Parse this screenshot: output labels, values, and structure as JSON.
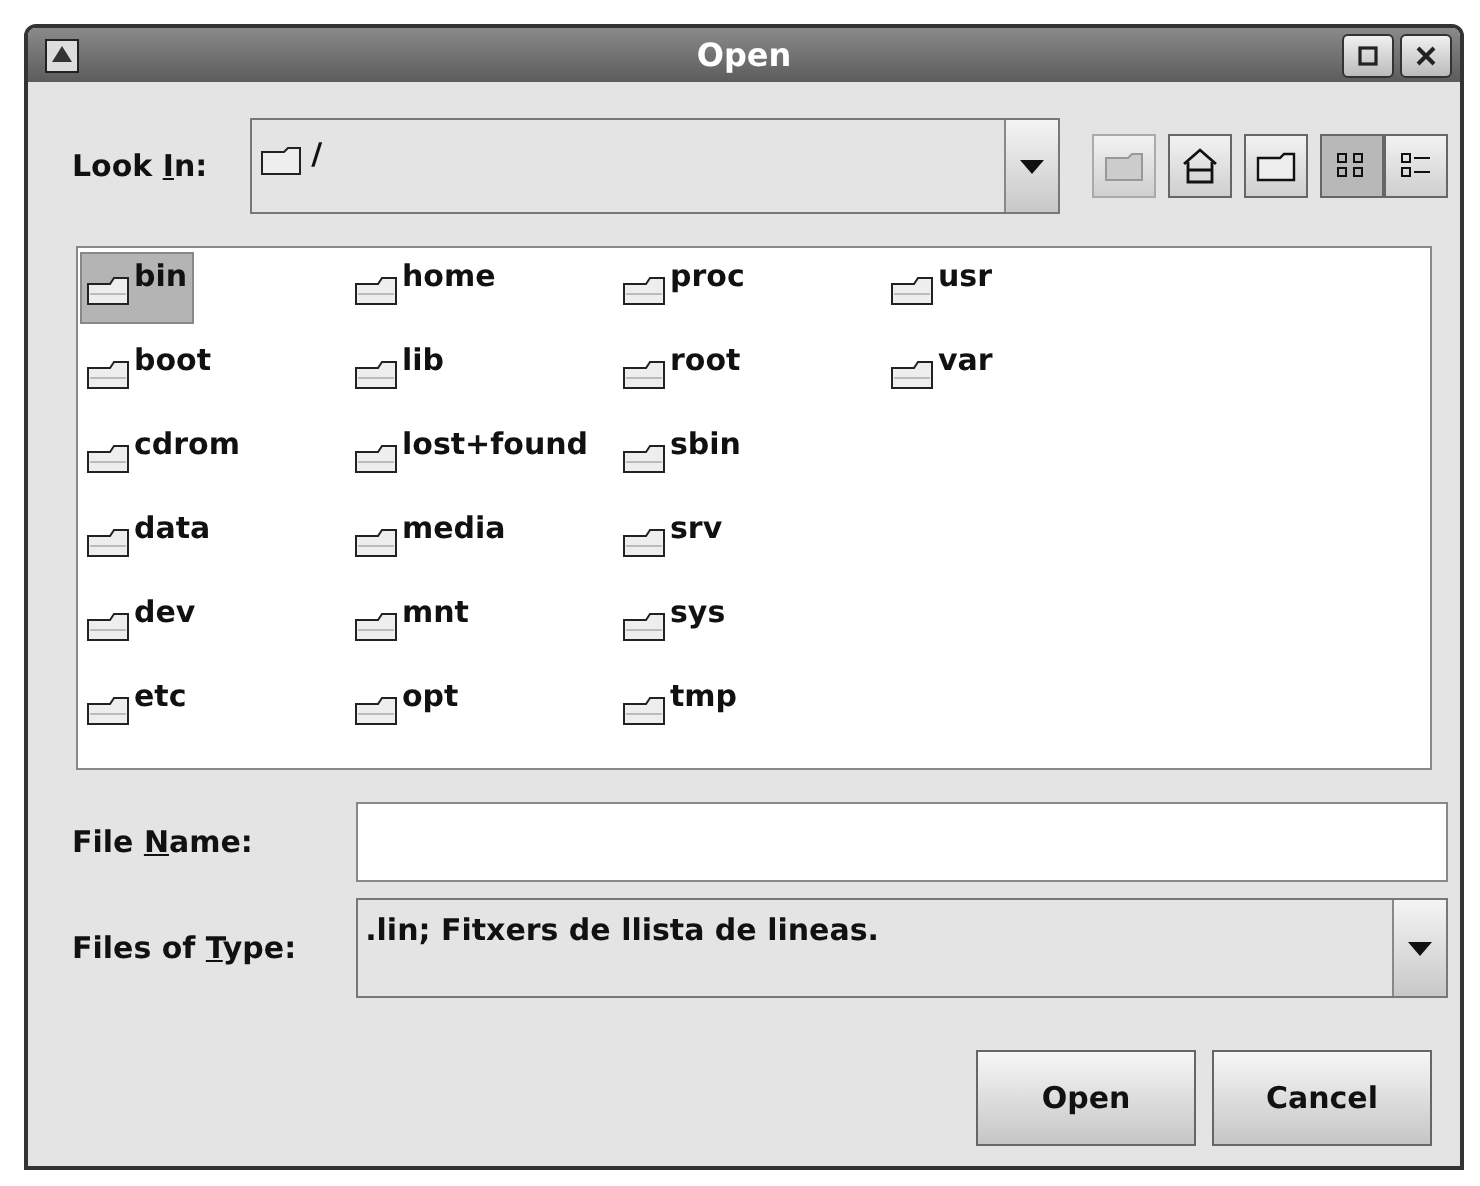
{
  "window": {
    "title": "Open"
  },
  "look_in": {
    "label": {
      "before": "Look ",
      "key": "I",
      "after": "n:"
    },
    "value": "/"
  },
  "files": [
    {
      "name": "bin",
      "selected": true
    },
    {
      "name": "boot",
      "selected": false
    },
    {
      "name": "cdrom",
      "selected": false
    },
    {
      "name": "data",
      "selected": false
    },
    {
      "name": "dev",
      "selected": false
    },
    {
      "name": "etc",
      "selected": false
    },
    {
      "name": "home",
      "selected": false
    },
    {
      "name": "lib",
      "selected": false
    },
    {
      "name": "lost+found",
      "selected": false
    },
    {
      "name": "media",
      "selected": false
    },
    {
      "name": "mnt",
      "selected": false
    },
    {
      "name": "opt",
      "selected": false
    },
    {
      "name": "proc",
      "selected": false
    },
    {
      "name": "root",
      "selected": false
    },
    {
      "name": "sbin",
      "selected": false
    },
    {
      "name": "srv",
      "selected": false
    },
    {
      "name": "sys",
      "selected": false
    },
    {
      "name": "tmp",
      "selected": false
    },
    {
      "name": "usr",
      "selected": false
    },
    {
      "name": "var",
      "selected": false
    }
  ],
  "file_name": {
    "label": {
      "before": "File ",
      "key": "N",
      "after": "ame:"
    }
  },
  "file_type": {
    "label": {
      "before": "Files of ",
      "key": "T",
      "after": "ype:"
    },
    "value": ".lin; Fitxers de llista de lineas."
  },
  "buttons": [
    "Open",
    "Cancel"
  ]
}
